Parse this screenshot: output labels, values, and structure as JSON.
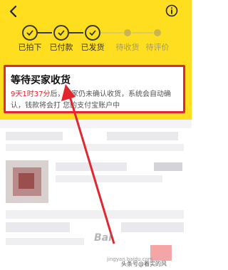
{
  "colors": {
    "header_bg": "#ffde1f",
    "highlight": "#e3262d",
    "time_text": "#e3262d"
  },
  "header": {
    "back_icon": "chevron-left-icon",
    "info_icon": "info-circle-icon"
  },
  "steps": [
    {
      "label": "已拍下",
      "done": true
    },
    {
      "label": "已付款",
      "done": true
    },
    {
      "label": "已发货",
      "done": true
    },
    {
      "label": "待收货",
      "done": false
    },
    {
      "label": "待评价",
      "done": false
    }
  ],
  "status_card": {
    "title": "等待买家收货",
    "time_remaining": "9天1时37分",
    "desc_part1": "后，",
    "desc_part2": "家仍未确认收货，系统会自动确认，钱款将会打",
    "desc_part3": "您的支付宝账户中"
  },
  "watermark": {
    "text": "Bai",
    "sub": "jingyan.baidu.com"
  },
  "credit": "头条号@着实的风"
}
